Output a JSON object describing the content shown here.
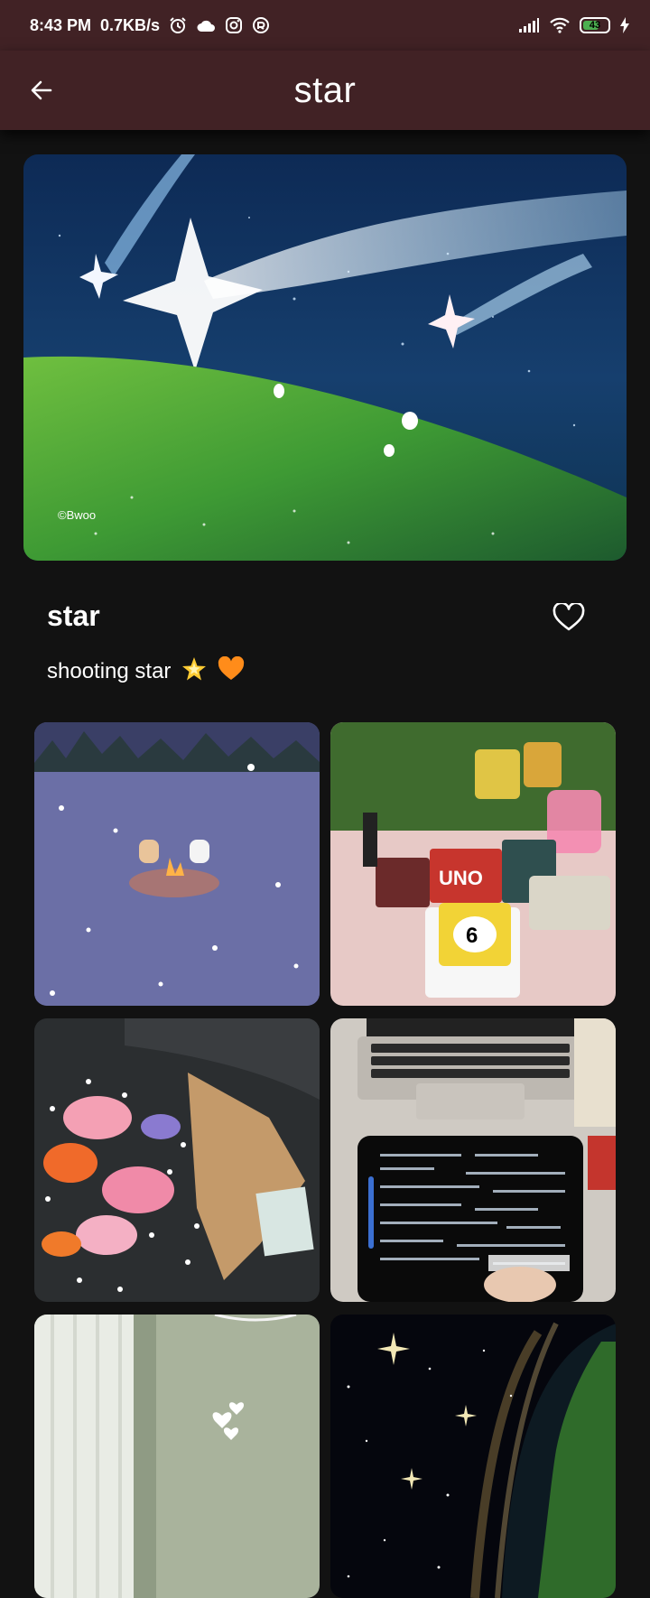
{
  "status_bar": {
    "time": "8:43 PM",
    "network_speed": "0.7KB/s",
    "left_icons": [
      "alarm-icon",
      "cloud-icon",
      "instagram-icon",
      "app-notification-icon"
    ],
    "right_icons": [
      "signal-icon",
      "wifi-icon",
      "battery-icon",
      "charging-icon"
    ],
    "battery_level": "43",
    "battery_color": "#4caf50"
  },
  "app_bar": {
    "title": "star",
    "back_icon": "arrow-left-icon",
    "background": "#412225"
  },
  "hero": {
    "watermark": "©Bwoo",
    "description": "shooting star illustration"
  },
  "post": {
    "title": "star",
    "description": "shooting star",
    "description_emojis": [
      "glowing-star-emoji",
      "orange-heart-emoji"
    ],
    "like_icon": "heart-outline-icon"
  },
  "grid": {
    "items": [
      {
        "subject": "snowy-campfire-cats"
      },
      {
        "subject": "picnic-games"
      },
      {
        "subject": "flower-bouquet"
      },
      {
        "subject": "laptop-tablet-notes"
      },
      {
        "subject": "curtain-window-hearts"
      },
      {
        "subject": "starry-night-sky"
      }
    ]
  },
  "colors": {
    "background": "#121212",
    "app_bar": "#412225",
    "text": "#ffffff"
  }
}
